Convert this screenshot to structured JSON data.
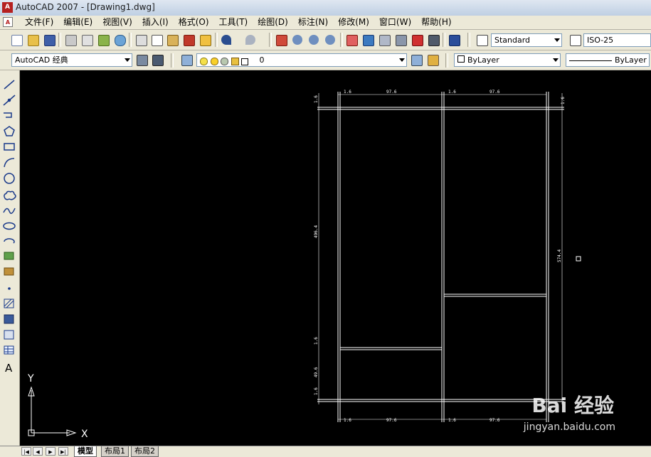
{
  "window": {
    "title": "AutoCAD 2007 - [Drawing1.dwg]",
    "icon_text": "A"
  },
  "menu": {
    "items": [
      {
        "label": "文件(F)"
      },
      {
        "label": "编辑(E)"
      },
      {
        "label": "视图(V)"
      },
      {
        "label": "插入(I)"
      },
      {
        "label": "格式(O)"
      },
      {
        "label": "工具(T)"
      },
      {
        "label": "绘图(D)"
      },
      {
        "label": "标注(N)"
      },
      {
        "label": "修改(M)"
      },
      {
        "label": "窗口(W)"
      },
      {
        "label": "帮助(H)"
      }
    ]
  },
  "toolbar1": {
    "text_style": "Standard",
    "dim_style": "ISO-25"
  },
  "toolbar2": {
    "workspace": "AutoCAD 经典",
    "layer": "0",
    "color": "ByLayer",
    "linetype": "ByLayer"
  },
  "left_tools": [
    "line-icon",
    "construction-line-icon",
    "polyline-icon",
    "polygon-icon",
    "rectangle-icon",
    "arc-icon",
    "circle-icon",
    "revision-cloud-icon",
    "spline-icon",
    "ellipse-icon",
    "ellipse-arc-icon",
    "insert-block-icon",
    "make-block-icon",
    "point-icon",
    "hatch-icon",
    "gradient-icon",
    "region-icon",
    "table-icon",
    "multiline-text-icon"
  ],
  "left_text_tool": "A",
  "canvas": {
    "background": "#000000",
    "ucs": {
      "x_label": "X",
      "y_label": "Y"
    },
    "dimensions": {
      "top_left_small": "1.6",
      "top_left_main": "97.6",
      "top_right_small": "1.6",
      "top_right_main": "97.6",
      "right_top_small": "1.6",
      "left_top_small": "1.6",
      "left_tall": "496.4",
      "right_tall": "574.4",
      "left_mid_small": "1.6",
      "left_lower": "49.6",
      "left_bottom_small": "1.6",
      "bottom_left_small": "1.6",
      "bottom_left_main": "97.6",
      "bottom_right_small": "1.6",
      "bottom_right_main": "97.6"
    }
  },
  "layout_tabs": [
    {
      "label": "模型",
      "active": true
    },
    {
      "label": "布局1",
      "active": false
    },
    {
      "label": "布局2",
      "active": false
    }
  ],
  "watermark": {
    "brand": "Bai  经验",
    "url": "jingyan.baidu.com"
  }
}
